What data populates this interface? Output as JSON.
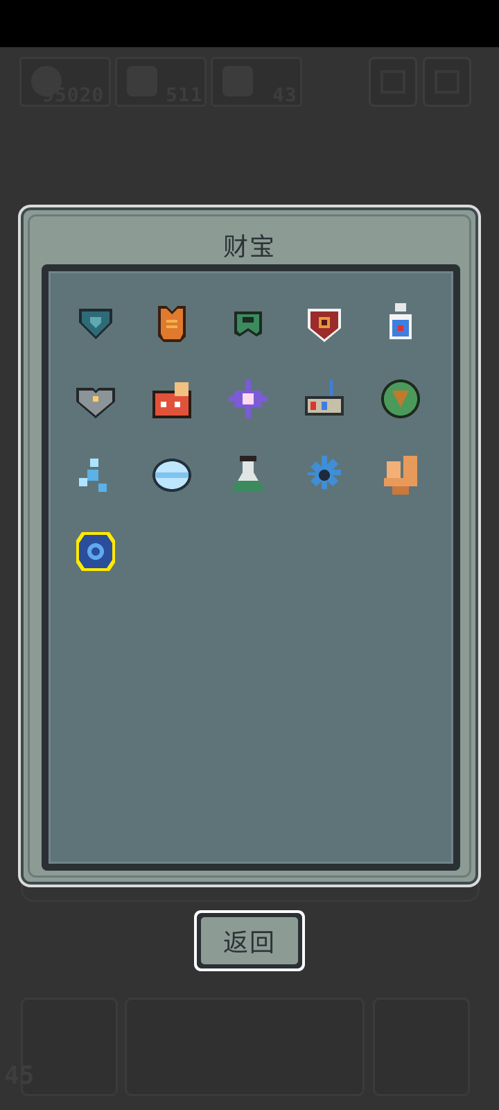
{
  "hud": {
    "gems": "95020",
    "energy": "511",
    "fish": "43",
    "bottom_count": "45"
  },
  "panel": {
    "title": "财宝"
  },
  "treasures": [
    {
      "icon": "teal-heart-gem-icon"
    },
    {
      "icon": "orange-armor-icon"
    },
    {
      "icon": "green-helmet-icon"
    },
    {
      "icon": "lion-shield-icon"
    },
    {
      "icon": "potion-bottle-icon"
    },
    {
      "icon": "gray-heart-core-icon"
    },
    {
      "icon": "red-fox-creature-icon"
    },
    {
      "icon": "purple-star-flower-icon"
    },
    {
      "icon": "shopping-basket-icon"
    },
    {
      "icon": "leaf-orb-icon"
    },
    {
      "icon": "ice-figure-icon"
    },
    {
      "icon": "light-blue-disc-icon"
    },
    {
      "icon": "green-flask-icon"
    },
    {
      "icon": "blue-gear-icon"
    },
    {
      "icon": "toilet-icon"
    },
    {
      "icon": "blue-crystal-ring-icon",
      "selected": true
    }
  ],
  "buttons": {
    "back": "返回"
  }
}
